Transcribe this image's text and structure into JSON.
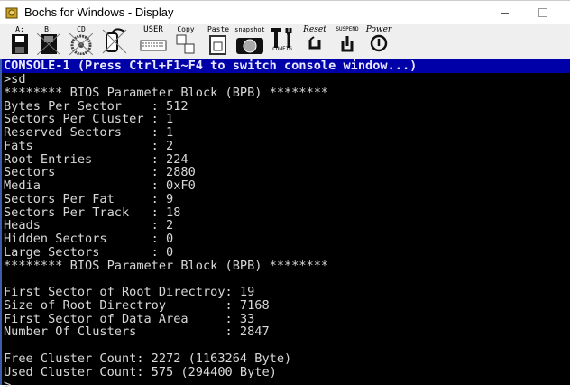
{
  "window": {
    "title": "Bochs for Windows - Display"
  },
  "toolbar": {
    "floppy_a": "A:",
    "floppy_b": "B:",
    "cdrom": "CD",
    "user": "USER",
    "copy": "Copy",
    "paste": "Paste",
    "snapshot": "snapshot",
    "config": "CONFIG",
    "reset": "Reset",
    "suspend": "SUSPEND",
    "power": "Power"
  },
  "console": {
    "header": "CONSOLE-1 (Press Ctrl+F1~F4 to switch console window...)",
    "lines": [
      ">sd",
      "******** BIOS Parameter Block (BPB) ********",
      "Bytes Per Sector    : 512",
      "Sectors Per Cluster : 1",
      "Reserved Sectors    : 1",
      "Fats                : 2",
      "Root Entries        : 224",
      "Sectors             : 2880",
      "Media               : 0xF0",
      "Sectors Per Fat     : 9",
      "Sectors Per Track   : 18",
      "Heads               : 2",
      "Hidden Sectors      : 0",
      "Large Sectors       : 0",
      "******** BIOS Parameter Block (BPB) ********",
      "",
      "First Sector of Root Directroy: 19",
      "Size of Root Directroy        : 7168",
      "First Sector of Data Area     : 33",
      "Number Of Clusters            : 2847",
      "",
      "Free Cluster Count: 2272 (1163264 Byte)",
      "Used Cluster Count: 575 (294400 Byte)",
      ">"
    ]
  }
}
